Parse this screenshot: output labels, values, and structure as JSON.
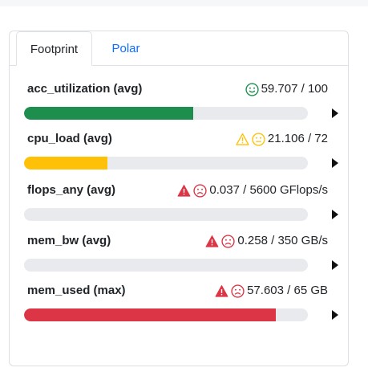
{
  "tabs": [
    {
      "label": "Footprint",
      "active": true
    },
    {
      "label": "Polar",
      "active": false
    }
  ],
  "colors": {
    "ok": "#1e8e4f",
    "warn": "#ffc107",
    "danger": "#dc3545",
    "track": "#e8eaed"
  },
  "metrics": [
    {
      "name": "acc_utilization (avg)",
      "value_text": "59.707 / 100",
      "fill_fraction": 0.597,
      "fill_color": "#1e8e4f",
      "icons": [
        "smile-face-icon"
      ]
    },
    {
      "name": "cpu_load (avg)",
      "value_text": "21.106 / 72",
      "fill_fraction": 0.293,
      "fill_color": "#ffc107",
      "icons": [
        "warning-triangle-icon",
        "neutral-face-icon"
      ]
    },
    {
      "name": "flops_any (avg)",
      "value_text": "0.037 / 5600 GFlops/s",
      "fill_fraction": 0.0,
      "fill_color": "#dc3545",
      "icons": [
        "alert-triangle-icon",
        "frown-face-icon"
      ]
    },
    {
      "name": "mem_bw (avg)",
      "value_text": "0.258 / 350 GB/s",
      "fill_fraction": 0.0,
      "fill_color": "#dc3545",
      "icons": [
        "alert-triangle-icon",
        "frown-face-icon"
      ]
    },
    {
      "name": "mem_used (max)",
      "value_text": "57.603 / 65 GB",
      "fill_fraction": 0.886,
      "fill_color": "#dc3545",
      "icons": [
        "alert-triangle-icon",
        "frown-face-icon"
      ]
    }
  ]
}
